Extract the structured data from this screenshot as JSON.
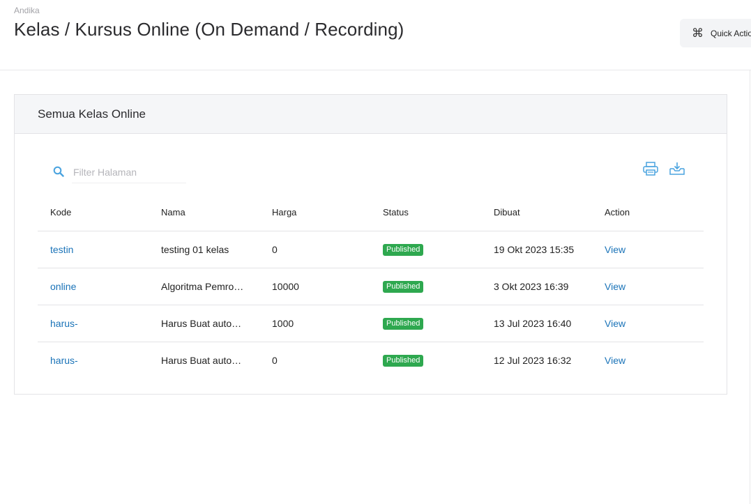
{
  "header": {
    "breadcrumb": "Andika",
    "title": "Kelas / Kursus Online (On Demand / Recording)",
    "quick_actions_label": "Quick Actions"
  },
  "card": {
    "title": "Semua Kelas Online",
    "search": {
      "placeholder": "Filter Halaman",
      "value": ""
    }
  },
  "table": {
    "headers": {
      "kode": "Kode",
      "nama": "Nama",
      "harga": "Harga",
      "status": "Status",
      "dibuat": "Dibuat",
      "action": "Action"
    },
    "rows": [
      {
        "kode": "testin",
        "nama": "testing 01 kelas",
        "harga": "0",
        "status": "Published",
        "dibuat": "19 Okt 2023 15:35",
        "action": "View"
      },
      {
        "kode": "online",
        "nama": "Algoritma Pemrograman",
        "harga": "10000",
        "status": "Published",
        "dibuat": "3 Okt 2023 16:39",
        "action": "View"
      },
      {
        "kode": "harus-",
        "nama": "Harus Buat automatis",
        "harga": "1000",
        "status": "Published",
        "dibuat": "13 Jul 2023 16:40",
        "action": "View"
      },
      {
        "kode": "harus-",
        "nama": "Harus Buat automatis",
        "harga": "0",
        "status": "Published",
        "dibuat": "12 Jul 2023 16:32",
        "action": "View"
      }
    ]
  },
  "colors": {
    "link": "#1a73b8",
    "badge": "#2ea84f",
    "icon": "#4aa3df"
  },
  "icons": {
    "search": "search-icon",
    "print": "print-icon",
    "download": "download-icon",
    "command": "command-icon"
  }
}
